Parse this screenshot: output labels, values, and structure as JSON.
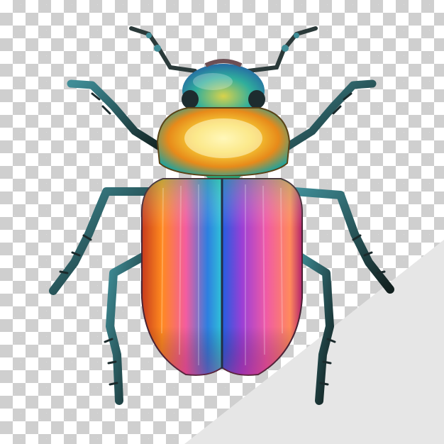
{
  "image": {
    "subject": "beetle-illustration",
    "background": "transparency-checkerboard",
    "colors": {
      "checker_light": "#ffffff",
      "checker_dark": "#cfcfcf",
      "corner_panel": "#e6e6e6",
      "leg_dark": "#1b2a2c",
      "leg_teal": "#2f6f78",
      "pronotum_gold": "#f7d23a",
      "elytra_orange": "#ff8a1e",
      "elytra_blue": "#2d7fe0",
      "elytra_pink": "#e94aa8",
      "elytra_magenta": "#b2216e"
    }
  }
}
